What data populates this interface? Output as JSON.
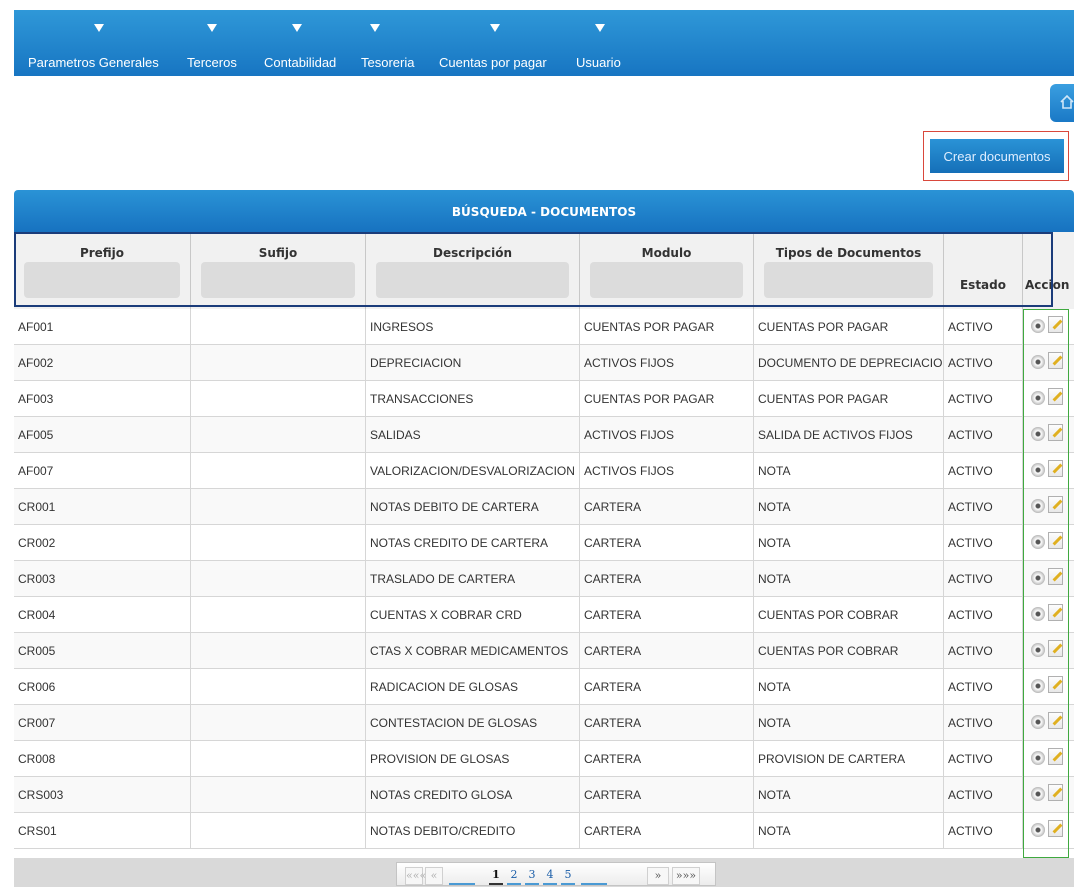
{
  "nav": {
    "items": [
      {
        "label": "Parametros Generales"
      },
      {
        "label": "Terceros"
      },
      {
        "label": "Contabilidad"
      },
      {
        "label": "Tesoreria"
      },
      {
        "label": "Cuentas por pagar"
      },
      {
        "label": "Usuario"
      }
    ]
  },
  "toolbar": {
    "create_label": "Crear documentos"
  },
  "panel": {
    "title": "BÚSQUEDA - DOCUMENTOS"
  },
  "columns": {
    "prefijo": "Prefijo",
    "sufijo": "Sufijo",
    "descripcion": "Descripción",
    "modulo": "Modulo",
    "tipos": "Tipos de Documentos",
    "estado": "Estado",
    "accion": "Accion"
  },
  "rows": [
    {
      "prefijo": "AF001",
      "sufijo": "",
      "descripcion": "INGRESOS",
      "modulo": "CUENTAS POR PAGAR",
      "tipo": "CUENTAS POR PAGAR",
      "estado": "ACTIVO"
    },
    {
      "prefijo": "AF002",
      "sufijo": "",
      "descripcion": "DEPRECIACION",
      "modulo": "ACTIVOS FIJOS",
      "tipo": "DOCUMENTO DE DEPRECIACION",
      "estado": "ACTIVO"
    },
    {
      "prefijo": "AF003",
      "sufijo": "",
      "descripcion": "TRANSACCIONES",
      "modulo": "CUENTAS POR PAGAR",
      "tipo": "CUENTAS POR PAGAR",
      "estado": "ACTIVO"
    },
    {
      "prefijo": "AF005",
      "sufijo": "",
      "descripcion": "SALIDAS",
      "modulo": "ACTIVOS FIJOS",
      "tipo": "SALIDA DE ACTIVOS FIJOS",
      "estado": "ACTIVO"
    },
    {
      "prefijo": "AF007",
      "sufijo": "",
      "descripcion": "VALORIZACION/DESVALORIZACION",
      "modulo": "ACTIVOS FIJOS",
      "tipo": "NOTA",
      "estado": "ACTIVO"
    },
    {
      "prefijo": "CR001",
      "sufijo": "",
      "descripcion": "NOTAS DEBITO DE CARTERA",
      "modulo": "CARTERA",
      "tipo": "NOTA",
      "estado": "ACTIVO"
    },
    {
      "prefijo": "CR002",
      "sufijo": "",
      "descripcion": "NOTAS CREDITO DE CARTERA",
      "modulo": "CARTERA",
      "tipo": "NOTA",
      "estado": "ACTIVO"
    },
    {
      "prefijo": "CR003",
      "sufijo": "",
      "descripcion": "TRASLADO DE CARTERA",
      "modulo": "CARTERA",
      "tipo": "NOTA",
      "estado": "ACTIVO"
    },
    {
      "prefijo": "CR004",
      "sufijo": "",
      "descripcion": "CUENTAS X COBRAR CRD",
      "modulo": "CARTERA",
      "tipo": "CUENTAS POR COBRAR",
      "estado": "ACTIVO"
    },
    {
      "prefijo": "CR005",
      "sufijo": "",
      "descripcion": "CTAS X COBRAR MEDICAMENTOS",
      "modulo": "CARTERA",
      "tipo": "CUENTAS POR COBRAR",
      "estado": "ACTIVO"
    },
    {
      "prefijo": "CR006",
      "sufijo": "",
      "descripcion": "RADICACION DE GLOSAS",
      "modulo": "CARTERA",
      "tipo": "NOTA",
      "estado": "ACTIVO"
    },
    {
      "prefijo": "CR007",
      "sufijo": "",
      "descripcion": "CONTESTACION DE GLOSAS",
      "modulo": "CARTERA",
      "tipo": "NOTA",
      "estado": "ACTIVO"
    },
    {
      "prefijo": "CR008",
      "sufijo": "",
      "descripcion": "PROVISION DE GLOSAS",
      "modulo": "CARTERA",
      "tipo": "PROVISION DE CARTERA",
      "estado": "ACTIVO"
    },
    {
      "prefijo": "CRS003",
      "sufijo": "",
      "descripcion": "NOTAS CREDITO GLOSA",
      "modulo": "CARTERA",
      "tipo": "NOTA",
      "estado": "ACTIVO"
    },
    {
      "prefijo": "CRS01",
      "sufijo": "",
      "descripcion": "NOTAS DEBITO/CREDITO",
      "modulo": "CARTERA",
      "tipo": "NOTA",
      "estado": "ACTIVO"
    }
  ],
  "row_icons": {
    "view": "eye-icon",
    "edit": "edit-icon"
  },
  "pager": {
    "first": "«««",
    "prev": "«",
    "pages": [
      "1",
      "2",
      "3",
      "4",
      "5"
    ],
    "current": "1",
    "next": "»",
    "last": "»»»"
  },
  "colors": {
    "accent": "#1f84cc",
    "selection_outline": "#d9483b",
    "action_outline": "#3fa93f",
    "filter_outline": "#1b3c7a"
  }
}
